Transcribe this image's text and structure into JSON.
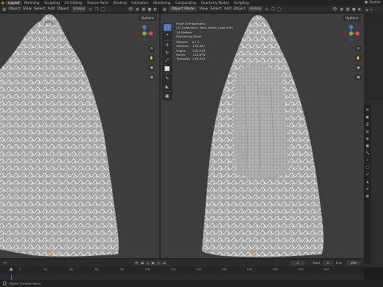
{
  "topbar": {
    "workspaces": [
      "Layout",
      "Modeling",
      "Sculpting",
      "UV Editing",
      "Texture Paint",
      "Shading",
      "Animation",
      "Rendering",
      "Compositing",
      "Geometry Nodes",
      "Scripting"
    ],
    "active_index": 0,
    "scene_label": "Scene"
  },
  "left_viewport": {
    "header": {
      "mode": "Object",
      "menus": [
        "View",
        "Select",
        "Add",
        "Object"
      ],
      "orientation": "Global"
    },
    "options_label": "Options"
  },
  "right_viewport": {
    "header": {
      "mode": "Object Mode",
      "menus": [
        "View",
        "Select",
        "Add",
        "Object"
      ],
      "orientation": "Global"
    },
    "options_label": "Options",
    "overlay": {
      "view_name": "Front Orthographic",
      "collection_line": "(1) Collection | lace_dress_cape.trim",
      "unit_line": "10 Meters",
      "rendering_line": "Rendering Done",
      "stats": [
        {
          "label": "Objects",
          "value": "0 / 1"
        },
        {
          "label": "Vertices",
          "value": "135,347"
        },
        {
          "label": "Edges",
          "value": "250,228"
        },
        {
          "label": "Faces",
          "value": "124,878"
        },
        {
          "label": "Triangles",
          "value": "239,333"
        }
      ]
    }
  },
  "toolbar": {
    "tools": [
      {
        "icon": "select-box-icon",
        "glyph": "⬚",
        "active": true
      },
      {
        "icon": "cursor-icon",
        "glyph": "⌖",
        "active": false
      },
      {
        "icon": "move-icon",
        "glyph": "✛",
        "active": false
      },
      {
        "icon": "rotate-icon",
        "glyph": "↻",
        "active": false
      },
      {
        "icon": "scale-icon",
        "glyph": "⤢",
        "active": false
      },
      {
        "icon": "transform-icon",
        "glyph": "⬜",
        "active": false
      },
      {
        "icon": "annotate-icon",
        "glyph": "✎",
        "active": false
      },
      {
        "icon": "measure-icon",
        "glyph": "◣",
        "active": false
      },
      {
        "icon": "add-cube-icon",
        "glyph": "▣",
        "active": false
      }
    ]
  },
  "gizmo": {
    "x": "X",
    "y": "Y",
    "z": "Z"
  },
  "timeline": {
    "current_frame": "1",
    "start_label": "Start",
    "start_value": "1",
    "end_label": "End",
    "end_value": "250",
    "ruler_ticks": [
      "0",
      "20",
      "40",
      "60",
      "80",
      "100",
      "120",
      "140",
      "160",
      "180",
      "200",
      "220",
      "240"
    ],
    "highlight_tick": "1"
  },
  "statusbar": {
    "hint": "Object Context Menu"
  },
  "colors": {
    "accent": "#4772b3",
    "x_axis": "#e04050",
    "y_axis": "#80c020",
    "z_axis": "#3a80e0",
    "viewport_bg": "#3d3d3d"
  }
}
